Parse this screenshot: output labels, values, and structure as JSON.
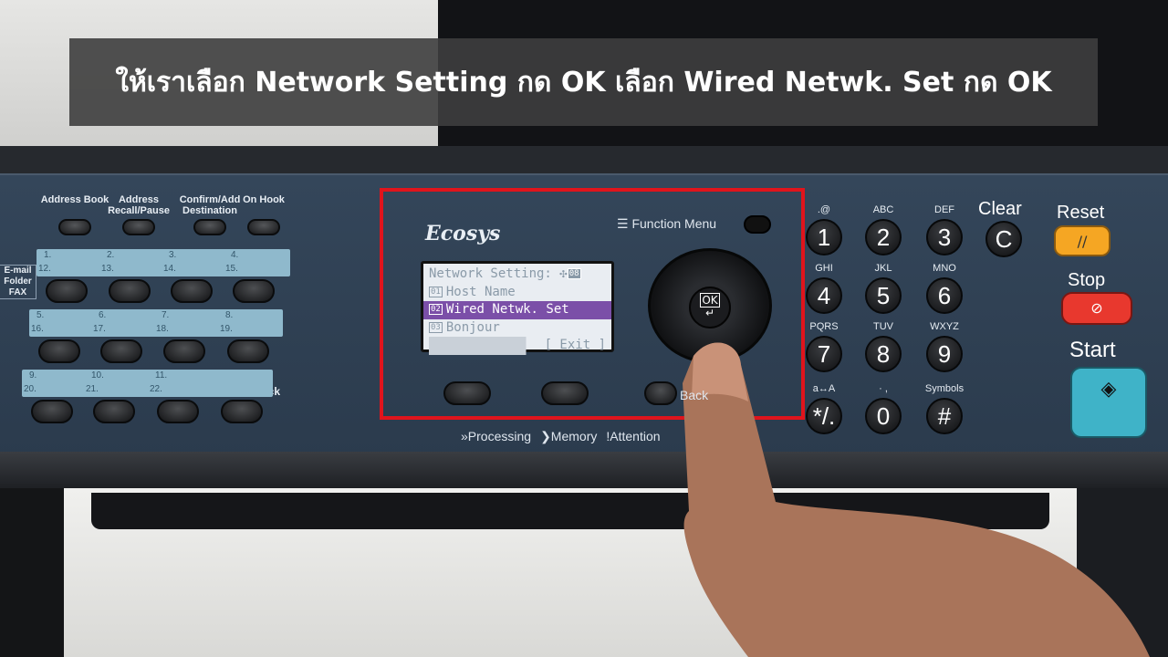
{
  "caption": "ให้เราเลือก Network Setting กด OK เลือก Wired Netwk. Set กด OK",
  "brand": "Ecosys",
  "left_panel": {
    "top_buttons": [
      "Address Book",
      "Address Recall/Pause",
      "Confirm/Add Destination",
      "On Hook"
    ],
    "side_label": "E-mail Folder FAX",
    "rows": [
      {
        "top": [
          "1.",
          "2.",
          "3.",
          "4."
        ],
        "bottom": [
          "12.",
          "13.",
          "14.",
          "15."
        ]
      },
      {
        "top": [
          "5.",
          "6.",
          "7.",
          "8."
        ],
        "bottom": [
          "16.",
          "17.",
          "18.",
          "19."
        ]
      },
      {
        "top": [
          "9.",
          "10.",
          "11.",
          ""
        ],
        "bottom": [
          "20.",
          "21.",
          "22.",
          ""
        ]
      }
    ],
    "shift_lock": "Shift Lock"
  },
  "function_menu": "Function Menu",
  "lcd": {
    "title": "Network Setting:",
    "page_badge": "08",
    "items": [
      {
        "num": "01",
        "label": "Host Name"
      },
      {
        "num": "02",
        "label": "Wired Netwk. Set",
        "selected": true
      },
      {
        "num": "03",
        "label": "Bonjour"
      }
    ],
    "softkey": "[ Exit ]"
  },
  "ok_label": "OK",
  "back_label": "Back",
  "indicators": [
    "Processing",
    "Memory",
    "Attention"
  ],
  "keypad": [
    {
      "key": "1",
      "sub": ".@"
    },
    {
      "key": "2",
      "sub": "ABC"
    },
    {
      "key": "3",
      "sub": "DEF"
    },
    {
      "key": "4",
      "sub": "GHI"
    },
    {
      "key": "5",
      "sub": "JKL"
    },
    {
      "key": "6",
      "sub": "MNO"
    },
    {
      "key": "7",
      "sub": "PQRS"
    },
    {
      "key": "8",
      "sub": "TUV"
    },
    {
      "key": "9",
      "sub": "WXYZ"
    },
    {
      "key": "*/.",
      "sub": "a↔A"
    },
    {
      "key": "0",
      "sub": "· ,"
    },
    {
      "key": "#",
      "sub": "Symbols"
    }
  ],
  "clear": {
    "label": "Clear",
    "key": "C"
  },
  "reset": {
    "label": "Reset",
    "color": "#f5a623"
  },
  "stop": {
    "label": "Stop",
    "color": "#e8382e"
  },
  "start": {
    "label": "Start",
    "color": "#3fb3c8"
  }
}
